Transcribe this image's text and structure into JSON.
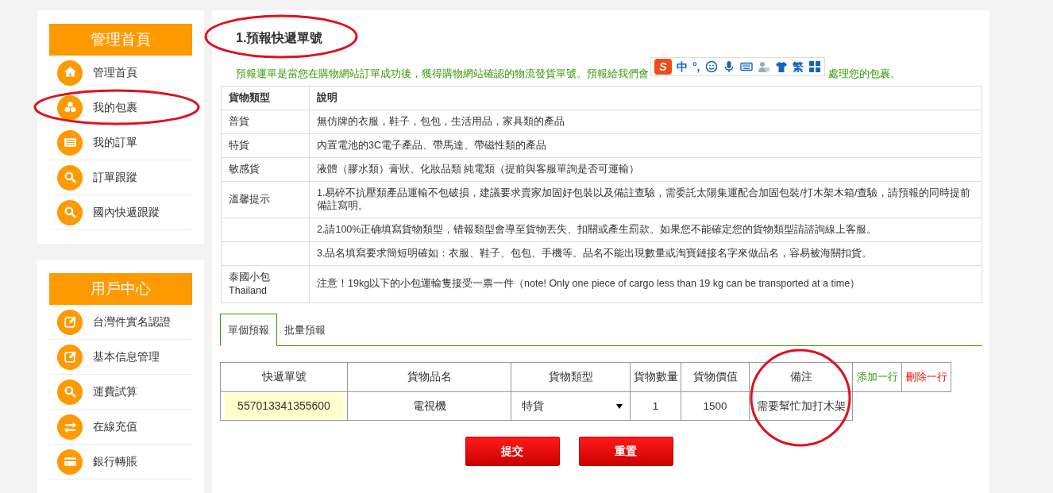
{
  "sidebar": [
    {
      "header": "管理首頁",
      "items": [
        {
          "label": "管理首頁",
          "kind": "home",
          "circled": false
        },
        {
          "label": "我的包裹",
          "kind": "cubes",
          "circled": true
        },
        {
          "label": "我的訂單",
          "kind": "list",
          "circled": false
        },
        {
          "label": "訂單跟蹤",
          "kind": "search",
          "circled": false
        },
        {
          "label": "國內快遞跟蹤",
          "kind": "search",
          "circled": false
        }
      ]
    },
    {
      "header": "用戶中心",
      "items": [
        {
          "label": "台灣件實名認證",
          "kind": "edit",
          "circled": false
        },
        {
          "label": "基本信息管理",
          "kind": "edit",
          "circled": false
        },
        {
          "label": "運費試算",
          "kind": "search",
          "circled": false
        },
        {
          "label": "在線充值",
          "kind": "exchange",
          "circled": false
        },
        {
          "label": "銀行轉賬",
          "kind": "card",
          "circled": false
        }
      ]
    }
  ],
  "page": {
    "title": "1.預報快遞單號",
    "title_circled": true,
    "notice_parts": [
      "預報運單是當您在購物網站訂單成功後，獲得購物網站確認的物流發貨單號。預報給我們會",
      "處理您的包裹。"
    ]
  },
  "ime_toolbar": [
    {
      "kind": "logo",
      "text": "S"
    },
    {
      "kind": "text",
      "text": "中"
    },
    {
      "kind": "text",
      "text": "°,"
    },
    {
      "kind": "smiley"
    },
    {
      "kind": "mic"
    },
    {
      "kind": "keyboard"
    },
    {
      "kind": "user"
    },
    {
      "kind": "shirt"
    },
    {
      "kind": "text",
      "text": "繁"
    },
    {
      "kind": "grid"
    }
  ],
  "info_table": {
    "columns": [
      "貨物類型",
      "說明"
    ],
    "rows": [
      [
        "普貨",
        "無仿牌的衣服，鞋子，包包，生活用品，家具類的產品"
      ],
      [
        "特貨",
        "內置電池的3C電子產品、帶馬達、帶磁性類的產品"
      ],
      [
        "敏感貨",
        "液體（膠水類）膏狀、化妝品類 純電類（提前與客服單詢是否可運輸）"
      ],
      [
        "溫馨提示",
        "1.易碎不抗壓類產品運輸不包破損，建議要求賣家加固好包裝以及備註查驗，需委託太陽集運配合加固包裝/打木架木箱/查驗，請預報的同時提前備註寫明。"
      ],
      [
        "",
        "2.請100%正确填寫貨物類型，错報類型會導至貨物丟失、扣關或產生罰款。如果您不能確定您的貨物類型請諮詢線上客服。"
      ],
      [
        "",
        "3.品名填寫要求簡短明確如：衣服、鞋子、包包、手機等。品名不能出現數量或淘寶鏈接名字來做品名，容易被海關扣貨。"
      ],
      [
        "泰國小包\nThailand",
        "注意！19kg以下的小包運輸隻接受一票一件（note! Only one piece of cargo less than 19 kg can be transported at a time）"
      ]
    ]
  },
  "tabs": [
    {
      "label": "單個預報",
      "selected": true
    },
    {
      "label": "批量預報",
      "selected": false
    }
  ],
  "form": {
    "columns": [
      {
        "label": "快遞單號",
        "circled": false
      },
      {
        "label": "貨物品名",
        "circled": false
      },
      {
        "label": "貨物類型",
        "circled": false
      },
      {
        "label": "貨物數量",
        "circled": false
      },
      {
        "label": "貨物價值",
        "circled": false
      },
      {
        "label": "備注",
        "circled": true
      }
    ],
    "actions": [
      {
        "kind": "add",
        "label": "添加一行"
      },
      {
        "kind": "delete",
        "label": "刪除一行"
      }
    ],
    "row": {
      "tracking": "557013341355600",
      "name": "電視機",
      "type": "特貨",
      "quantity": "1",
      "value": "1500",
      "remark": "需要幫忙加打木架"
    }
  },
  "buttons": [
    "提交",
    "重置"
  ]
}
